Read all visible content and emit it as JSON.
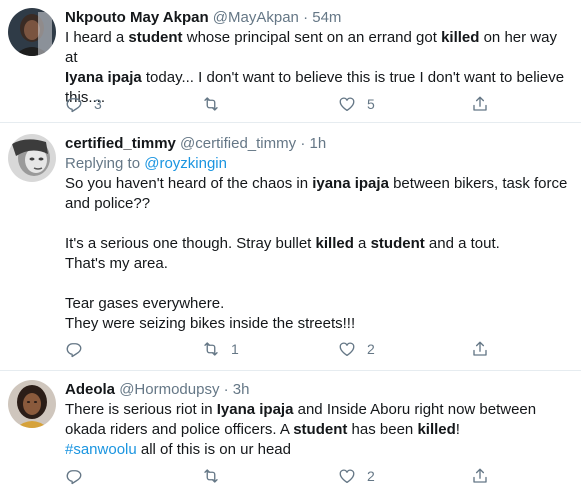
{
  "tweets": [
    {
      "name": "Nkpouto May Akpan",
      "handle": "@MayAkpan",
      "sep": "·",
      "time": "54m",
      "lines": [
        [
          {
            "t": "I heard a "
          },
          {
            "b": "student"
          },
          {
            "t": " whose principal sent on an errand got "
          },
          {
            "b": "killed"
          },
          {
            "t": " on her way at"
          }
        ],
        [
          {
            "b": "Iyana ipaja"
          },
          {
            "t": " today... I don't want to believe this is true I don't want to believe"
          }
        ],
        [
          {
            "t": "this...."
          }
        ]
      ],
      "replies": "3",
      "retweets": "",
      "likes": "5"
    },
    {
      "name": "certified_timmy",
      "handle": "@certified_timmy",
      "sep": "·",
      "time": "1h",
      "replying_label": "Replying to ",
      "replying_to": "@royzkingin",
      "lines": [
        [
          {
            "t": "So you haven't heard of the chaos in "
          },
          {
            "b": "iyana ipaja"
          },
          {
            "t": " between bikers, task force"
          }
        ],
        [
          {
            "t": "and police??"
          }
        ],
        [],
        [
          {
            "t": "It's a serious one though. Stray bullet "
          },
          {
            "b": "killed"
          },
          {
            "t": " a "
          },
          {
            "b": "student"
          },
          {
            "t": " and a tout."
          }
        ],
        [
          {
            "t": "That's my area."
          }
        ],
        [],
        [
          {
            "t": "Tear gases everywhere."
          }
        ],
        [
          {
            "t": "They were seizing bikes inside the streets!!!"
          }
        ]
      ],
      "replies": "",
      "retweets": "1",
      "likes": "2"
    },
    {
      "name": "Adeola",
      "handle": "@Hormodupsy",
      "sep": "·",
      "time": "3h",
      "lines": [
        [
          {
            "t": "There is serious riot in "
          },
          {
            "b": "Iyana ipaja"
          },
          {
            "t": " and Inside Aboru right now between"
          }
        ],
        [
          {
            "t": "okada riders and police officers. A "
          },
          {
            "b": "student"
          },
          {
            "t": " has been "
          },
          {
            "b": "killed"
          },
          {
            "t": "!"
          }
        ],
        [
          {
            "h": "#sanwoolu"
          },
          {
            "t": " all of this is on ur head"
          }
        ]
      ],
      "replies": "",
      "retweets": "",
      "likes": "2"
    }
  ],
  "icons": {
    "reply": "reply-icon",
    "retweet": "retweet-icon",
    "like": "heart-icon",
    "share": "share-icon"
  },
  "colors": {
    "text": "#14171a",
    "muted": "#657786",
    "link": "#1b95e0",
    "border": "#e6ecf0"
  }
}
